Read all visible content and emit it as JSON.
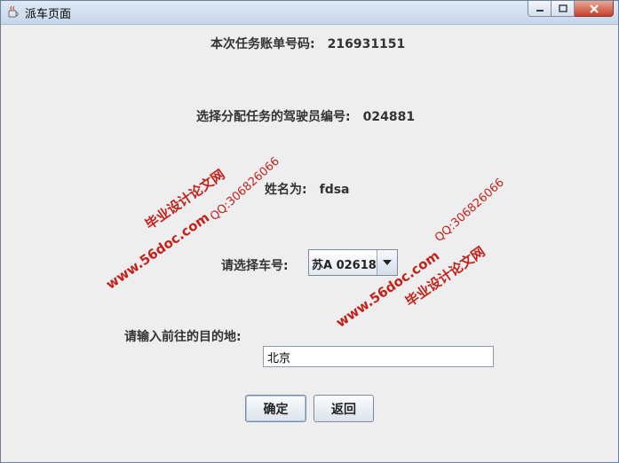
{
  "window": {
    "title": "派车页面",
    "icon": "java-cup-icon",
    "controls": [
      "minimize-icon",
      "maximize-icon",
      "close-icon"
    ]
  },
  "form": {
    "bill_label": "本次任务账单号码:",
    "bill_value": "216931151",
    "driver_label": "选择分配任务的驾驶员编号:",
    "driver_value": "024881",
    "name_label": "姓名为:",
    "name_value": "fdsa",
    "car_label": "请选择车号:",
    "car_selected": "苏A 02618",
    "dest_label": "请输入前往的目的地:",
    "dest_value": "北京"
  },
  "buttons": {
    "confirm": "确定",
    "back": "返回"
  },
  "watermark": {
    "site": "www.56doc.com",
    "qq": "QQ:306826066",
    "name": "毕业设计论文网",
    "color": "#c2211c"
  }
}
